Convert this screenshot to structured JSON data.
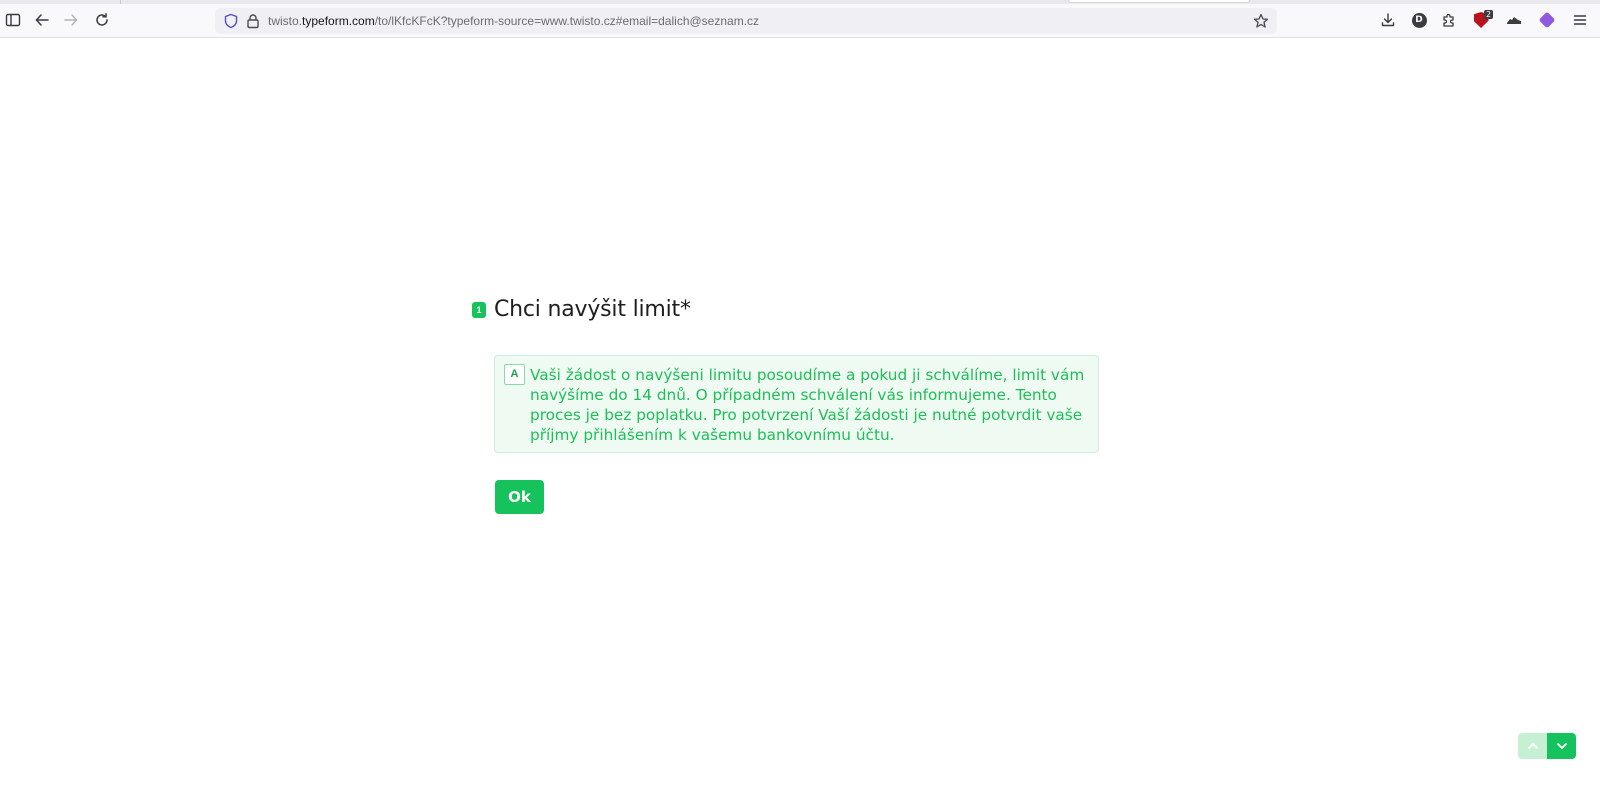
{
  "browser": {
    "url_prefix": "twisto.",
    "url_host": "typeform.com",
    "url_rest": "/to/lKfcKFcK?typeform-source=www.twisto.cz#email=dalich@seznam.cz",
    "extension_avatar_letter": "D",
    "extension_badge_count": "2",
    "icons": [
      "sidebar-icon",
      "back-icon",
      "forward-icon",
      "reload-icon",
      "shield-icon",
      "lock-icon",
      "bookmark-star-icon",
      "download-icon",
      "extension-d-icon",
      "extensions-puzzle-icon",
      "ublock-shield-icon",
      "sneaker-icon",
      "purple-extension-icon",
      "menu-icon"
    ]
  },
  "form": {
    "question_number": "1",
    "question_title": "Chci navýšit limit*",
    "choices": [
      {
        "key": "A",
        "text": "Vaši žádost o navýšeni limitu posoudíme a pokud ji schválíme, limit vám navýšíme do 14 dnů. O případném schválení vás informujeme. Tento proces je bez poplatku. Pro potvrzení Vaší žádosti je nutné potvrdit vaše příjmy přihlášením k vašemu bankovnímu účtu."
      }
    ],
    "ok_label": "Ok"
  },
  "colors": {
    "accent": "#16c25b",
    "choice_bg": "#eefaf2",
    "choice_text": "#1fbf58"
  }
}
